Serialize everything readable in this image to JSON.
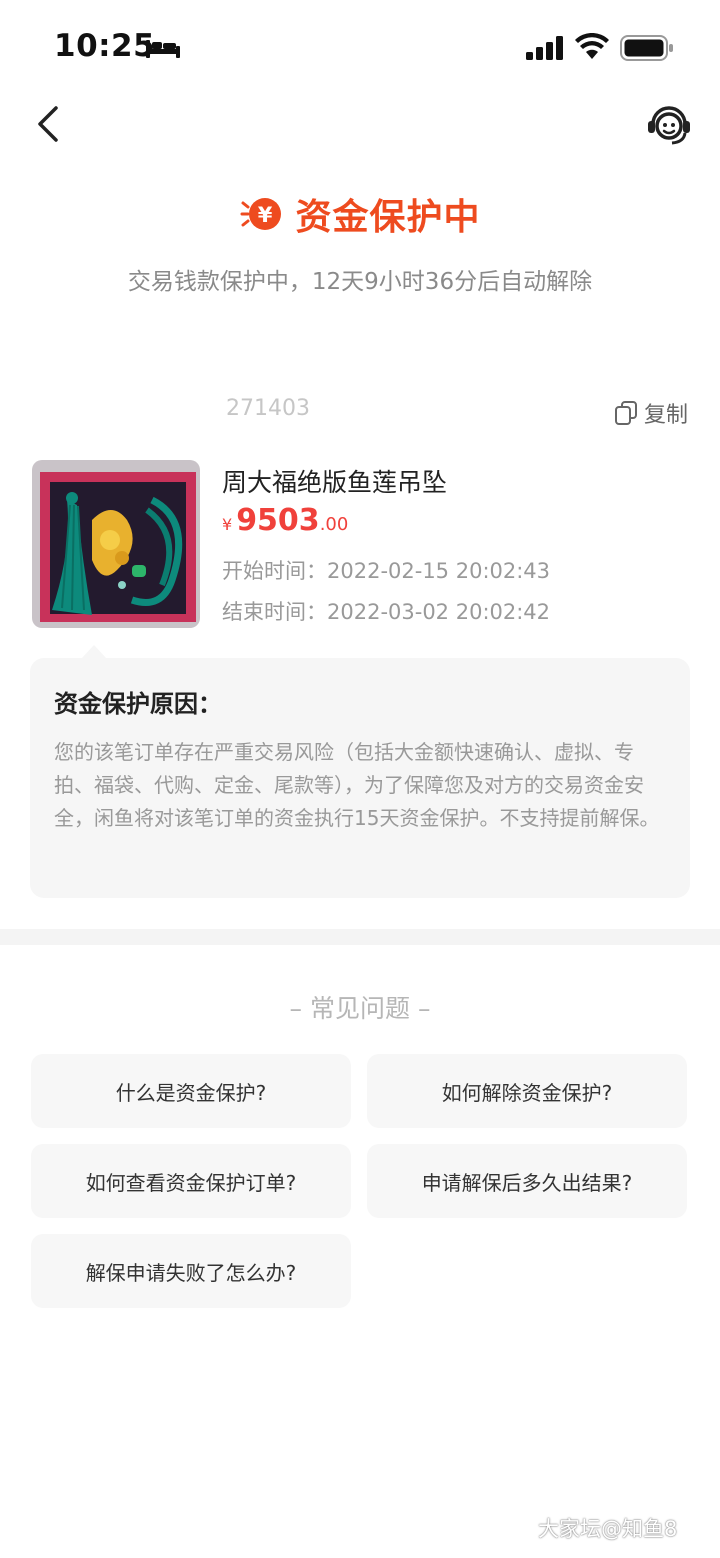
{
  "status_bar": {
    "time": "10:25"
  },
  "header": {
    "back_icon": "chevron-left-icon",
    "service_icon": "customer-service-icon"
  },
  "hero": {
    "title": "资金保护中",
    "subtitle": "交易钱款保护中，12天9小时36分后自动解除",
    "accent_color": "#ee4b1f"
  },
  "order": {
    "order_no_visible": "271403",
    "copy_label": "复制",
    "product_name": "周大福绝版鱼莲吊坠",
    "currency": "¥",
    "price_int": "9503",
    "price_dec": ".00",
    "start_time": "开始时间：2022-02-15 20:02:43",
    "end_time": "结束时间：2022-03-02 20:02:42"
  },
  "reason": {
    "title": "资金保护原因：",
    "body": "您的该笔订单存在严重交易风险（包括大金额快速确认、虚拟、专拍、福袋、代购、定金、尾款等），为了保障您及对方的交易资金安全，闲鱼将对该笔订单的资金执行15天资金保护。不支持提前解保。"
  },
  "faq": {
    "title": "– 常见问题 –",
    "items": [
      "什么是资金保护?",
      "如何解除资金保护?",
      "如何查看资金保护订单?",
      "申请解保后多久出结果?",
      "解保申请失败了怎么办?"
    ]
  },
  "watermark": "大家坛@知鱼8"
}
